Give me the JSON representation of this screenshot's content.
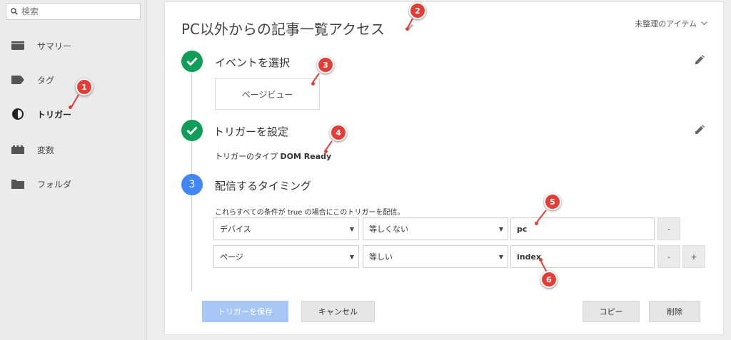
{
  "sidebar": {
    "search_placeholder": "検索",
    "items": [
      {
        "label": "サマリー",
        "icon": "summary-icon"
      },
      {
        "label": "タグ",
        "icon": "tag-icon"
      },
      {
        "label": "トリガー",
        "icon": "trigger-icon"
      },
      {
        "label": "変数",
        "icon": "variables-icon"
      },
      {
        "label": "フォルダ",
        "icon": "folder-icon"
      }
    ],
    "active": "トリガー"
  },
  "card": {
    "title": "PC以外からの記事一覧アクセス",
    "folder_label": "未整理のアイテム",
    "steps": {
      "event": {
        "title": "イベントを選択",
        "value": "ページビュー"
      },
      "trigger": {
        "title": "トリガーを設定",
        "type_label": "トリガーのタイプ",
        "type_value": "DOM Ready"
      },
      "timing": {
        "number": "3",
        "title": "配信するタイミング",
        "description": "これらすべての条件が true の場合にこのトリガーを配信。"
      }
    },
    "conditions": [
      {
        "variable": "デバイス",
        "operator": "等しくない",
        "value": "pc",
        "minus": "-",
        "plus": ""
      },
      {
        "variable": "ページ",
        "operator": "等しい",
        "value": "index",
        "minus": "-",
        "plus": "+"
      }
    ],
    "buttons": {
      "save": "トリガーを保存",
      "cancel": "キャンセル",
      "copy": "コピー",
      "delete": "削除"
    }
  },
  "annotations": [
    "1",
    "2",
    "3",
    "4",
    "5",
    "6"
  ],
  "colors": {
    "done_green": "#0f9d58",
    "step_blue": "#4285f4",
    "save_disabled": "#a8c6f5",
    "marker_red": "#e43d36"
  }
}
